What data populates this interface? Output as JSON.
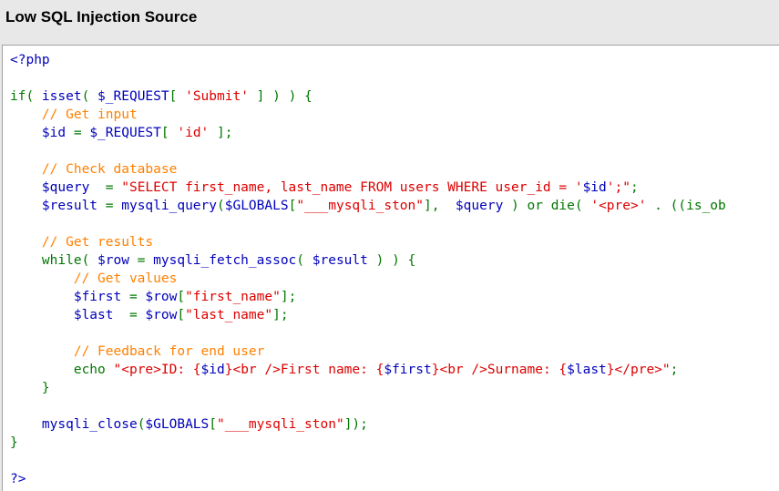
{
  "header": {
    "title": "Low SQL Injection Source"
  },
  "colors": {
    "default": "#0000bb",
    "keyword": "#007700",
    "string": "#dd0000",
    "comment": "#ff8000",
    "page_background": "#e8e8e8",
    "code_background": "#ffffff"
  },
  "source": {
    "lines": [
      [
        [
          "default",
          "<?php"
        ]
      ],
      [],
      [
        [
          "keyword",
          "if( "
        ],
        [
          "default",
          "isset"
        ],
        [
          "keyword",
          "( "
        ],
        [
          "default",
          "$_REQUEST"
        ],
        [
          "keyword",
          "[ "
        ],
        [
          "string",
          "'Submit'"
        ],
        [
          "keyword",
          " ] ) ) {"
        ]
      ],
      [
        [
          "comment",
          "    // Get input"
        ]
      ],
      [
        [
          "default",
          "    $id"
        ],
        [
          "keyword",
          " = "
        ],
        [
          "default",
          "$_REQUEST"
        ],
        [
          "keyword",
          "[ "
        ],
        [
          "string",
          "'id'"
        ],
        [
          "keyword",
          " ];"
        ]
      ],
      [],
      [
        [
          "comment",
          "    // Check database"
        ]
      ],
      [
        [
          "default",
          "    $query"
        ],
        [
          "keyword",
          "  = "
        ],
        [
          "string",
          "\"SELECT first_name, last_name FROM users WHERE user_id = '"
        ],
        [
          "default",
          "$id"
        ],
        [
          "string",
          "';\""
        ],
        [
          "keyword",
          ";"
        ]
      ],
      [
        [
          "default",
          "    $result"
        ],
        [
          "keyword",
          " = "
        ],
        [
          "default",
          "mysqli_query"
        ],
        [
          "keyword",
          "("
        ],
        [
          "default",
          "$GLOBALS"
        ],
        [
          "keyword",
          "["
        ],
        [
          "string",
          "\"___mysqli_ston\""
        ],
        [
          "keyword",
          "],  "
        ],
        [
          "default",
          "$query"
        ],
        [
          "keyword",
          " ) or die( "
        ],
        [
          "string",
          "'<pre>'"
        ],
        [
          "keyword",
          " . ((is_ob"
        ]
      ],
      [],
      [
        [
          "comment",
          "    // Get results"
        ]
      ],
      [
        [
          "keyword",
          "    while( "
        ],
        [
          "default",
          "$row"
        ],
        [
          "keyword",
          " = "
        ],
        [
          "default",
          "mysqli_fetch_assoc"
        ],
        [
          "keyword",
          "( "
        ],
        [
          "default",
          "$result"
        ],
        [
          "keyword",
          " ) ) {"
        ]
      ],
      [
        [
          "comment",
          "        // Get values"
        ]
      ],
      [
        [
          "default",
          "        $first"
        ],
        [
          "keyword",
          " = "
        ],
        [
          "default",
          "$row"
        ],
        [
          "keyword",
          "["
        ],
        [
          "string",
          "\"first_name\""
        ],
        [
          "keyword",
          "];"
        ]
      ],
      [
        [
          "default",
          "        $last"
        ],
        [
          "keyword",
          "  = "
        ],
        [
          "default",
          "$row"
        ],
        [
          "keyword",
          "["
        ],
        [
          "string",
          "\"last_name\""
        ],
        [
          "keyword",
          "];"
        ]
      ],
      [],
      [
        [
          "comment",
          "        // Feedback for end user"
        ]
      ],
      [
        [
          "keyword",
          "        echo "
        ],
        [
          "string",
          "\"<pre>ID: {"
        ],
        [
          "default",
          "$id"
        ],
        [
          "string",
          "}<br />First name: {"
        ],
        [
          "default",
          "$first"
        ],
        [
          "string",
          "}<br />Surname: {"
        ],
        [
          "default",
          "$last"
        ],
        [
          "string",
          "}</pre>\""
        ],
        [
          "keyword",
          ";"
        ]
      ],
      [
        [
          "keyword",
          "    }"
        ]
      ],
      [],
      [
        [
          "default",
          "    mysqli_close"
        ],
        [
          "keyword",
          "("
        ],
        [
          "default",
          "$GLOBALS"
        ],
        [
          "keyword",
          "["
        ],
        [
          "string",
          "\"___mysqli_ston\""
        ],
        [
          "keyword",
          "]);"
        ]
      ],
      [
        [
          "keyword",
          "}"
        ]
      ],
      [],
      [
        [
          "default",
          "?>"
        ]
      ]
    ]
  }
}
